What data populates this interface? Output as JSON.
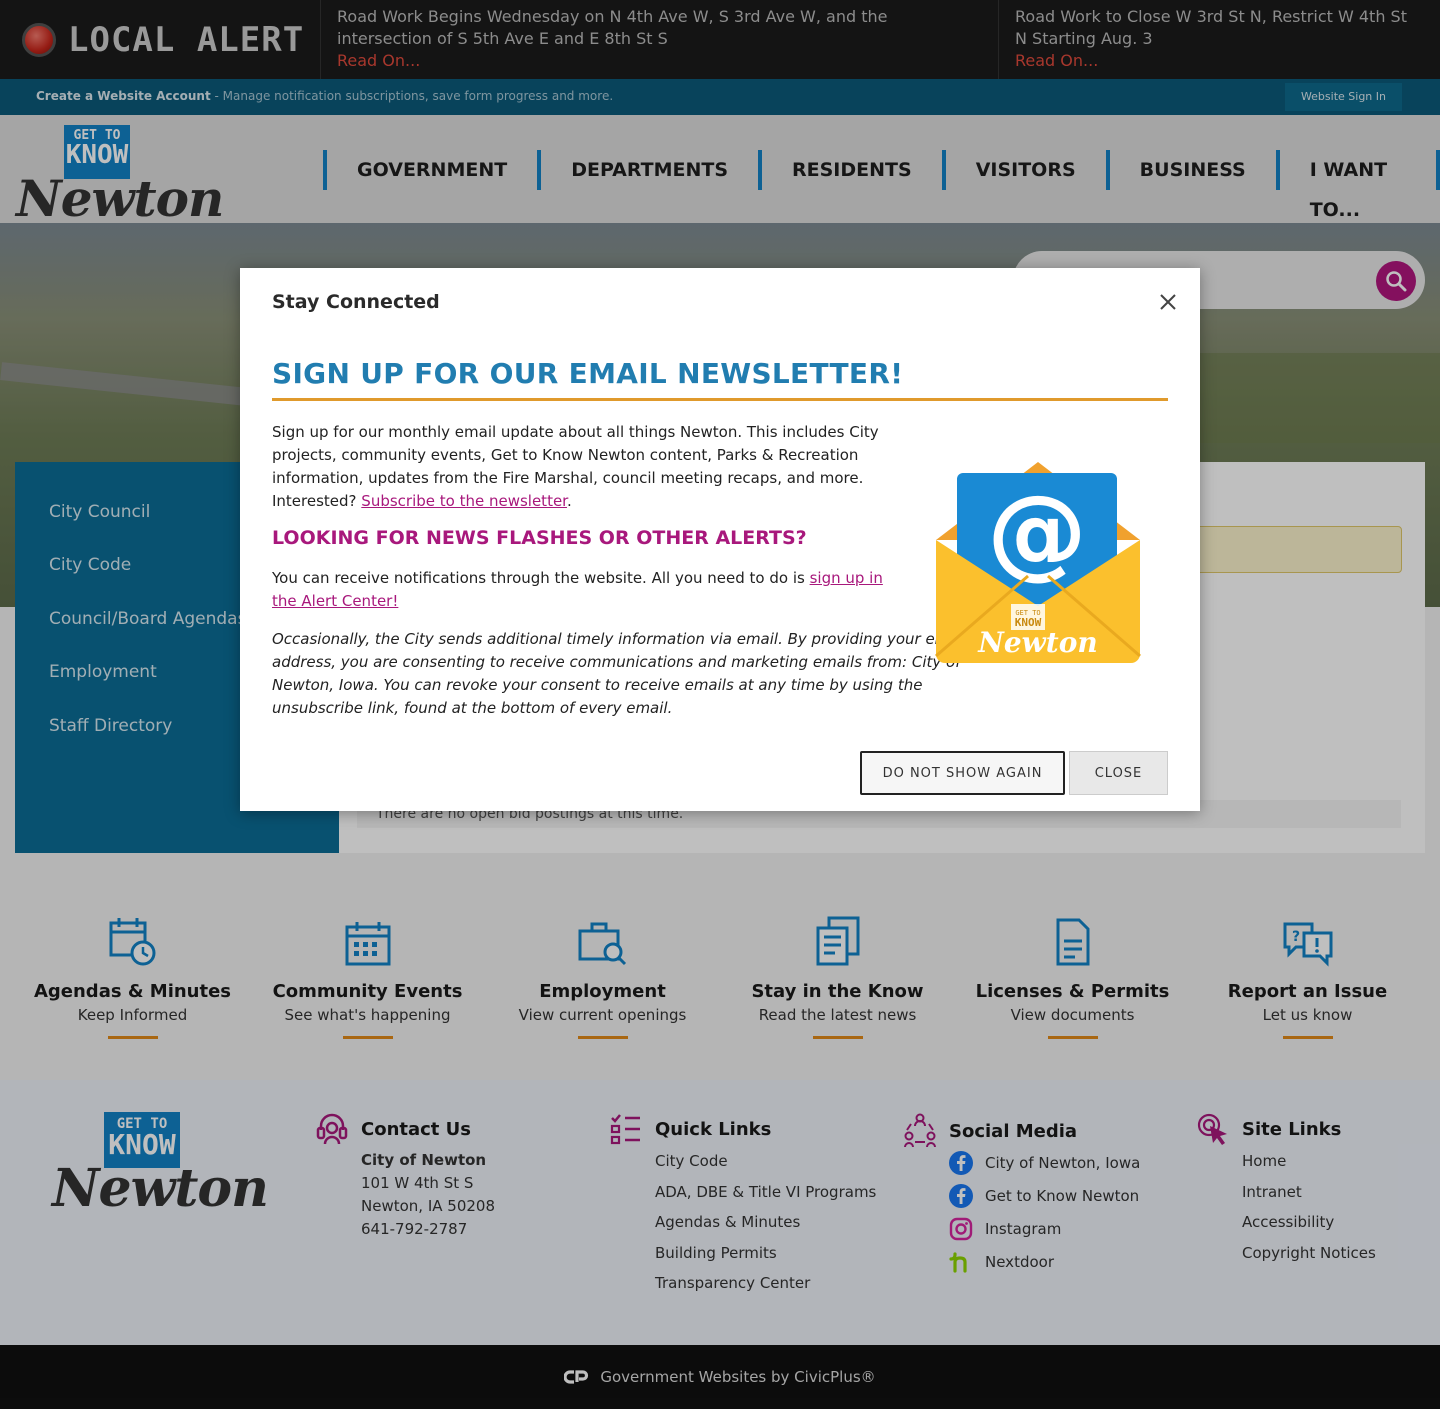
{
  "alert_bar": {
    "label": "LOCAL ALERT",
    "items": [
      {
        "text": "Road Work Begins Wednesday on N 4th Ave W, S 3rd Ave W, and the intersection of S 5th Ave E and E 8th St S",
        "read_more": "Read On..."
      },
      {
        "text": "Road Work to Close W 3rd St N, Restrict W 4th St N Starting Aug. 3",
        "read_more": "Read On..."
      }
    ]
  },
  "account_bar": {
    "create_label": "Create a Website Account",
    "create_desc": " - Manage notification subscriptions, save form progress and more.",
    "signin_label": "Website Sign In"
  },
  "logo": {
    "top": "GET TO",
    "mid": "KNOW",
    "name": "Newton"
  },
  "nav": [
    "GOVERNMENT",
    "DEPARTMENTS",
    "RESIDENTS",
    "VISITORS",
    "BUSINESS",
    "I WANT TO..."
  ],
  "side_nav": [
    "City Council",
    "City Code",
    "Council/Board Agendas",
    "Employment",
    "Staff Directory"
  ],
  "main": {
    "bid_text": "There are no open bid postings at this time."
  },
  "tiles": [
    {
      "title": "Agendas & Minutes",
      "subtitle": "Keep Informed",
      "icon": "calendar-clock-icon"
    },
    {
      "title": "Community Events",
      "subtitle": "See what's happening",
      "icon": "calendar-grid-icon"
    },
    {
      "title": "Employment",
      "subtitle": "View current openings",
      "icon": "briefcase-search-icon"
    },
    {
      "title": "Stay in the Know",
      "subtitle": "Read the latest news",
      "icon": "news-icon"
    },
    {
      "title": "Licenses & Permits",
      "subtitle": "View documents",
      "icon": "document-icon"
    },
    {
      "title": "Report an Issue",
      "subtitle": "Let us know",
      "icon": "chat-alert-icon"
    }
  ],
  "footer": {
    "contact": {
      "heading": "Contact Us",
      "org": "City of Newton",
      "address1": "101 W 4th St S",
      "address2": "Newton, IA 50208",
      "phone": "641-792-2787"
    },
    "quick_links": {
      "heading": "Quick Links",
      "items": [
        "City Code",
        "ADA, DBE & Title VI Programs",
        "Agendas & Minutes",
        "Building Permits",
        "Transparency Center"
      ]
    },
    "social": {
      "heading": "Social Media",
      "items": [
        "City of Newton, Iowa",
        "Get to Know Newton",
        "Instagram",
        "Nextdoor"
      ]
    },
    "site_links": {
      "heading": "Site Links",
      "items": [
        "Home",
        "Intranet",
        "Accessibility",
        "Copyright Notices"
      ]
    }
  },
  "bottom_bar": {
    "text": "Government Websites by CivicPlus®"
  },
  "modal": {
    "title": "Stay Connected",
    "heading": "SIGN UP FOR OUR EMAIL NEWSLETTER!",
    "para1": "Sign up for our monthly email update about all things Newton. This includes City projects, community events, Get to Know Newton content, Parks & Recreation information, updates from the Fire Marshal, council meeting recaps, and more. Interested?",
    "para1_link": "Subscribe to the newsletter",
    "heading2": "LOOKING FOR NEWS FLASHES OR OTHER ALERTS?",
    "para2": "You can receive notifications through the website. All you need to do is",
    "para2_link": "sign up in the Alert Center!",
    "para3": "Occasionally, the City sends additional timely information via email. By providing your email address, you are consenting to receive communications and marketing emails from: City of Newton, Iowa. You can revoke your consent to receive emails at any time by using the unsubscribe link, found at the bottom of every email.",
    "btn_dont_show": "DO NOT SHOW AGAIN",
    "btn_close": "CLOSE",
    "envelope_symbol": "@"
  },
  "colors": {
    "accent_blue": "#1282c6",
    "magenta": "#a8187c",
    "orange": "#e09a2c"
  }
}
